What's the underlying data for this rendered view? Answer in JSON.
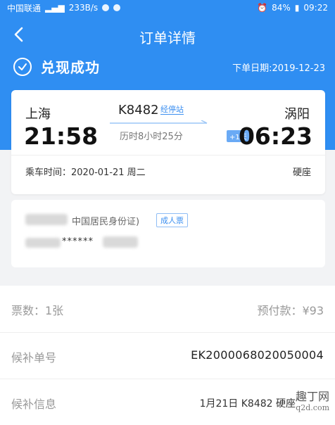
{
  "statusbar": {
    "carrier": "中国联通",
    "net_speed": "233B/s",
    "battery": "84%",
    "time": "09:22"
  },
  "header": {
    "title": "订单详情"
  },
  "order": {
    "status": "兑现成功",
    "date_label": "下单日期:2019-12-23"
  },
  "trip": {
    "from_city": "上海",
    "from_time": "21:58",
    "to_city": "涡阳",
    "to_time": "06:23",
    "train_no": "K8482",
    "stops_link": "经停站",
    "duration": "历时8小时25分",
    "plus_day": "+1天",
    "ride_time": "乘车时间：2020-01-21 周二",
    "seat_type": "硬座"
  },
  "passenger": {
    "id_type": "中国居民身份证)",
    "ticket_type": "成人票",
    "masked_id": "******"
  },
  "summary": {
    "ticket_count": "票数：1张",
    "prepay": "预付款：¥93",
    "waitlist_no_label": "候补单号",
    "waitlist_no": "EK2000068020050004",
    "waitlist_info_label": "候补信息",
    "waitlist_info": "1月21日 K8482 硬座"
  },
  "watermark": {
    "text": "趣丁网",
    "sub": "q2d.com"
  },
  "colors": {
    "brand_blue": "#2f8ef2",
    "link_blue": "#3a8ef0"
  }
}
